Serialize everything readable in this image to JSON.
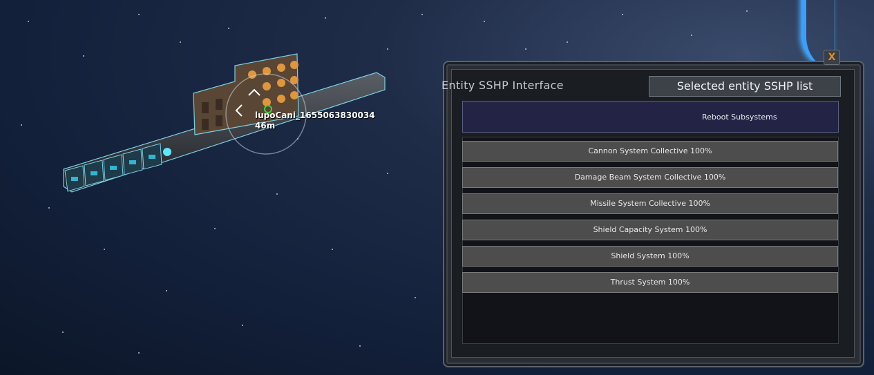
{
  "ship": {
    "name": "lupoCani_1655063830034",
    "distance": "46m"
  },
  "panel": {
    "title": "Entity SSHP Interface",
    "tab_selected": "Selected entity SSHP list",
    "close_label": "X",
    "reboot_label": "Reboot Subsystems",
    "systems": [
      "Cannon System Collective 100%",
      "Damage Beam System Collective 100%",
      "Missile System Collective 100%",
      "Shield Capacity System 100%",
      "Shield System 100%",
      "Thrust System 100%"
    ]
  },
  "colors": {
    "space": "#13203a",
    "accent_blue": "#3aa0ff",
    "close_x": "#e08a2a",
    "reboot_bg": "#232445",
    "row_bg": "#4d4d4d"
  }
}
